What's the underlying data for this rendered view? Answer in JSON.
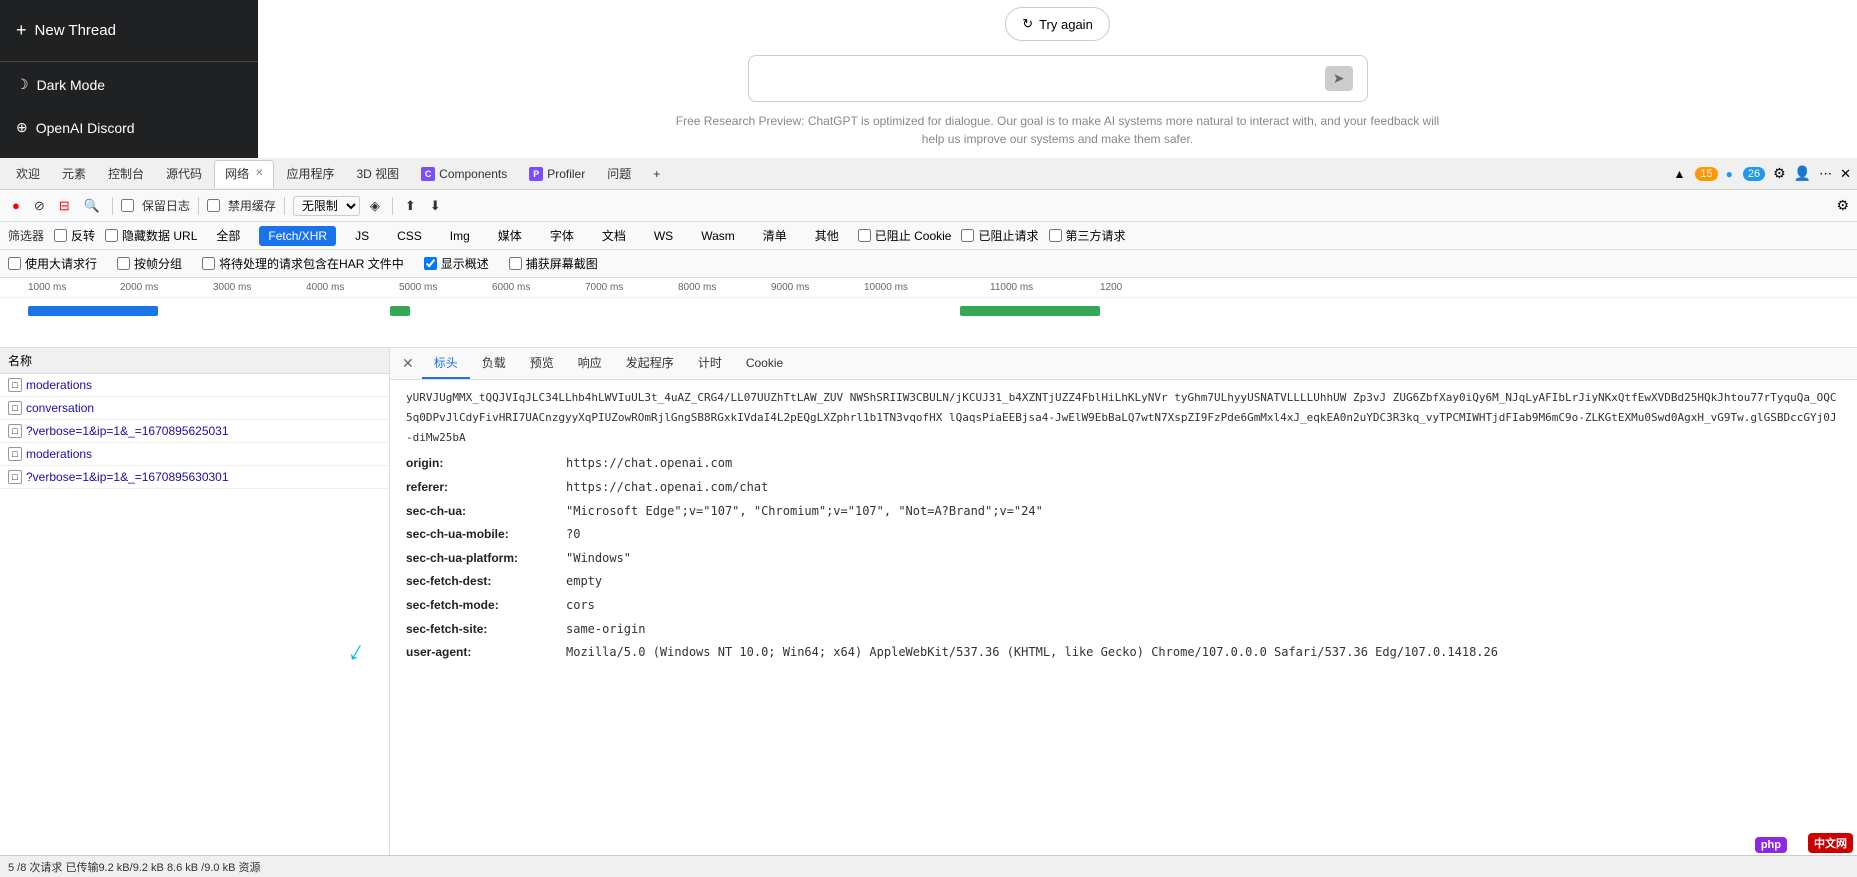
{
  "sidebar": {
    "new_thread_label": "New Thread",
    "dark_mode_label": "Dark Mode",
    "discord_label": "OpenAI Discord"
  },
  "chat": {
    "try_again_label": "Try again",
    "input_placeholder": "",
    "free_research_text": "Free Research Preview: ChatGPT is optimized for dialogue. Our goal is to make AI systems more natural to interact with, and your feedback will help us improve our systems and make them safer."
  },
  "devtools": {
    "tabs": [
      {
        "label": "欢迎",
        "active": false,
        "closeable": false
      },
      {
        "label": "元素",
        "active": false,
        "closeable": false
      },
      {
        "label": "控制台",
        "active": false,
        "closeable": false
      },
      {
        "label": "源代码",
        "active": false,
        "closeable": false
      },
      {
        "label": "网络",
        "active": true,
        "closeable": true
      },
      {
        "label": "应用程序",
        "active": false,
        "closeable": false
      },
      {
        "label": "3D 视图",
        "active": false,
        "closeable": false
      },
      {
        "label": "Components",
        "active": false,
        "closeable": false,
        "icon": "purple"
      },
      {
        "label": "Profiler",
        "active": false,
        "closeable": false,
        "icon": "purple"
      },
      {
        "label": "问题",
        "active": false,
        "closeable": false
      }
    ],
    "badge_orange": "15",
    "badge_blue": "26",
    "toolbar": {
      "record_label": "●",
      "stop_label": "⊘",
      "clear_label": "⊟",
      "search_label": "🔍",
      "preserve_log": "保留日志",
      "disable_cache": "禁用缓存",
      "throttle_label": "无限制",
      "import_label": "⬆",
      "export_label": "⬇"
    },
    "filter_label": "筛选器",
    "filter_options": {
      "invert": "反转",
      "hide_data_urls": "隐藏数据 URL",
      "all_label": "全部",
      "fetch_xhr": "Fetch/XHR",
      "js": "JS",
      "css": "CSS",
      "img": "Img",
      "media": "媒体",
      "font": "字体",
      "doc": "文档",
      "ws": "WS",
      "wasm": "Wasm",
      "manifest": "清单",
      "other": "其他",
      "blocked_cookie": "已阻止 Cookie",
      "blocked_request": "已阻止请求",
      "third_party": "第三方请求"
    },
    "options": {
      "large_rows": "使用大请求行",
      "group_by_frame": "按帧分组",
      "include_pending": "将待处理的请求包含在HAR 文件中",
      "show_overview": "显示概述",
      "capture_screenshot": "捕获屏幕截图"
    },
    "timeline_labels": [
      "1000 ms",
      "2000 ms",
      "3000 ms",
      "4000 ms",
      "5000 ms",
      "6000 ms",
      "7000 ms",
      "8000 ms",
      "9000 ms",
      "10000 ms",
      "11000 ms",
      "1200"
    ],
    "requests": [
      {
        "name": "moderations",
        "selected": false
      },
      {
        "name": "conversation",
        "selected": false
      },
      {
        "name": "?verbose=1&ip=1&_=1670895625031",
        "selected": false
      },
      {
        "name": "moderations",
        "selected": false
      },
      {
        "name": "?verbose=1&ip=1&_=1670895630301",
        "selected": false
      }
    ],
    "detail_tabs": [
      "标头",
      "负载",
      "预览",
      "响应",
      "发起程序",
      "计时",
      "Cookie"
    ],
    "active_detail_tab": "标头",
    "request_list_header": "名称",
    "detail_headers": {
      "truncated_data": "yURVJUgMMX_tQQJVIqJLC34LLhb4hLWVIuUL3t_4uAZ_CRG4/LL07UUZhTtLAW_ZUV NWShSRIIW3CBULN/jKCUJ31_b4XZNTjUZZ4FblHiLhKLyNVr tyGhm7ULhyyUSNATVLLLLUhhUW Zp3vJ ZUG6ZbfXay0iQy6M_NJqLyAFIbLrJiyNKxQtfEwXVDBd25HQkJhtou77rTyquQa_OQC5q0DPvJlCdyFivHRI7UACnzgyyXqPIUZowROmRjlGngSB8RGxkIVdaI4L2pEQgLXZphrl1b1TN3vqofHX lQaqsPiaEEBjsa4-JwElW9EbBaLQ7wtN7XspZI9FzPde6GmMxl4xJ_eqkEA0n2uYDC3R3kq_vyTPCMIWHTjdFIab9M6mC9o-ZLKGtEXMu0Swd0AgxH_vG9Tw.glGSBDccGYj0J-diMw25bA",
      "headers": [
        {
          "key": "origin:",
          "val": "https://chat.openai.com"
        },
        {
          "key": "referer:",
          "val": "https://chat.openai.com/chat"
        },
        {
          "key": "sec-ch-ua:",
          "val": "\"Microsoft Edge\";v=\"107\", \"Chromium\";v=\"107\", \"Not=A?Brand\";v=\"24\""
        },
        {
          "key": "sec-ch-ua-mobile:",
          "val": "?0"
        },
        {
          "key": "sec-ch-ua-platform:",
          "val": "\"Windows\""
        },
        {
          "key": "sec-fetch-dest:",
          "val": "empty"
        },
        {
          "key": "sec-fetch-mode:",
          "val": "cors"
        },
        {
          "key": "sec-fetch-site:",
          "val": "same-origin"
        },
        {
          "key": "user-agent:",
          "val": "Mozilla/5.0 (Windows NT 10.0; Win64; x64) AppleWebKit/537.36 (KHTML, like Gecko) Chrome/107.0.0.0 Safari/537.36 Edg/107.0.1418.26"
        }
      ]
    }
  },
  "statusbar": {
    "text": "5 /8 次请求  已传输9.2 kB/9.2 kB  8.6 kB /9.0 kB 资源"
  },
  "badges": {
    "php_label": "php",
    "zhongwenwang_label": "中文网"
  }
}
